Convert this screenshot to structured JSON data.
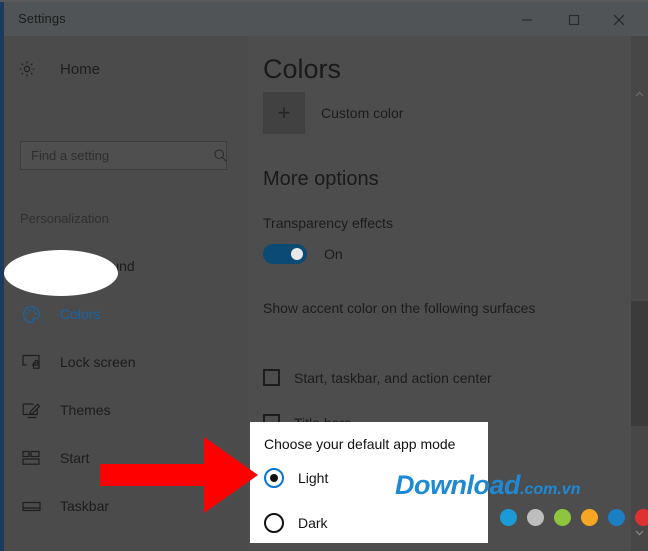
{
  "window": {
    "title": "Settings",
    "controls": {
      "minimize": "minimize-icon",
      "maximize": "maximize-icon",
      "close": "close-icon"
    }
  },
  "sidebar": {
    "home": {
      "label": "Home",
      "icon": "gear-icon"
    },
    "search": {
      "placeholder": "Find a setting",
      "value": "",
      "icon": "search-icon"
    },
    "section": "Personalization",
    "items": [
      {
        "label": "Background",
        "icon": "image-icon",
        "selected": false
      },
      {
        "label": "Colors",
        "icon": "palette-icon",
        "selected": true
      },
      {
        "label": "Lock screen",
        "icon": "lock-screen-icon",
        "selected": false
      },
      {
        "label": "Themes",
        "icon": "themes-icon",
        "selected": false
      },
      {
        "label": "Start",
        "icon": "start-icon",
        "selected": false
      },
      {
        "label": "Taskbar",
        "icon": "taskbar-icon",
        "selected": false
      }
    ]
  },
  "main": {
    "title": "Colors",
    "custom_color": {
      "label": "Custom color",
      "button_glyph": "+"
    },
    "more_options_title": "More options",
    "transparency": {
      "label": "Transparency effects",
      "state": "On",
      "enabled": true
    },
    "accent_surfaces_label": "Show accent color on the following surfaces",
    "checkboxes": [
      {
        "label": "Start, taskbar, and action center",
        "checked": false
      },
      {
        "label": "Title bars",
        "checked": false
      }
    ]
  },
  "app_mode_panel": {
    "title": "Choose your default app mode",
    "options": [
      {
        "label": "Light",
        "selected": true
      },
      {
        "label": "Dark",
        "selected": false
      }
    ]
  },
  "annotation": {
    "arrow_color": "#FF0000",
    "arrow_points_to": "Light radio button"
  },
  "watermark": {
    "brand": "Download",
    "domain": ".com.vn",
    "color": "#2089D4",
    "dots": [
      "#1C9AD6",
      "#BDBDBD",
      "#8CC63E",
      "#F5A623",
      "#1C7FC4",
      "#E03131"
    ]
  },
  "scrollbar": {
    "up_arrow": "chevron-up-icon",
    "down_arrow": "chevron-down-icon"
  },
  "colors": {
    "window_bg": "#4D4D4D",
    "sidebar_bg": "#4B4B4B",
    "titlebar_bg": "#515457",
    "accent": "#0A4A73",
    "highlight_text": "#1366A8"
  }
}
